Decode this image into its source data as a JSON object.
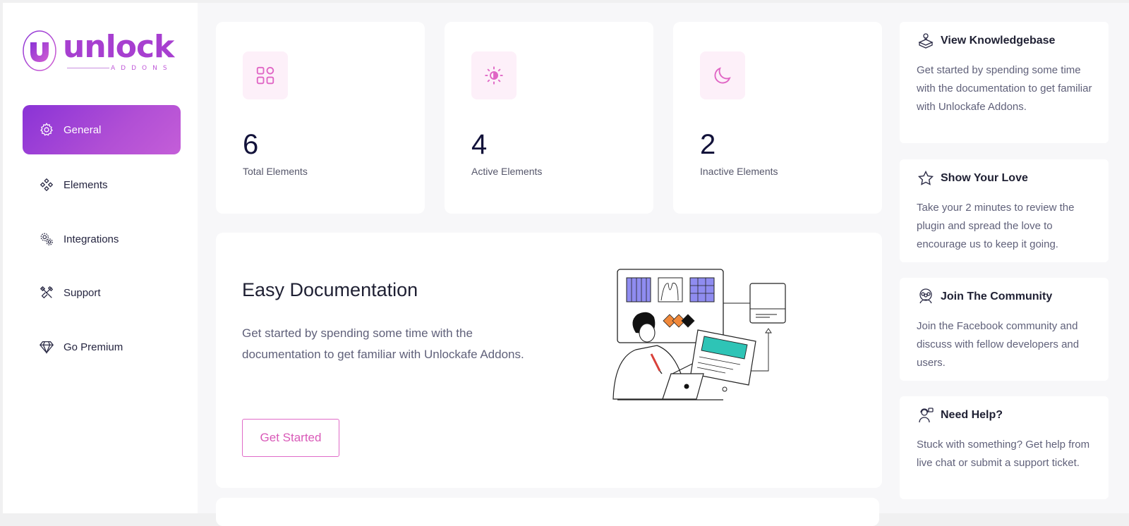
{
  "brand": {
    "name": "unlock",
    "tagline": "ADDONS",
    "accent": "#a73fd0"
  },
  "sidebar": {
    "items": [
      {
        "label": "General",
        "icon": "gear-icon",
        "active": true
      },
      {
        "label": "Elements",
        "icon": "elements-icon",
        "active": false
      },
      {
        "label": "Integrations",
        "icon": "integrations-icon",
        "active": false
      },
      {
        "label": "Support",
        "icon": "tools-icon",
        "active": false
      },
      {
        "label": "Go Premium",
        "icon": "diamond-icon",
        "active": false
      }
    ]
  },
  "stats": [
    {
      "value": "6",
      "label": "Total Elements",
      "icon": "grid-icon"
    },
    {
      "value": "4",
      "label": "Active Elements",
      "icon": "sun-icon"
    },
    {
      "value": "2",
      "label": "Inactive Elements",
      "icon": "moon-icon"
    }
  ],
  "documentation": {
    "title": "Easy Documentation",
    "text": "Get started by spending some time with the documentation to get familiar with Unlockafe Addons.",
    "button": "Get Started",
    "illustration": "developer-illustration"
  },
  "side_cards": [
    {
      "title": "View Knowledgebase",
      "icon": "knowledgebase-icon",
      "text": "Get started by spending some time with the documentation to get familiar with Unlockafe Addons."
    },
    {
      "title": "Show Your Love",
      "icon": "star-icon",
      "text": "Take your 2 minutes to review the plugin and spread the love to encourage us to keep it going."
    },
    {
      "title": "Join The Community",
      "icon": "community-icon",
      "text": "Join the Facebook community and discuss with fellow developers and users."
    },
    {
      "title": "Need Help?",
      "icon": "support-agent-icon",
      "text": "Stuck with something? Get help from live chat or submit a support ticket."
    }
  ],
  "colors": {
    "primary_gradient_start": "#8a33d6",
    "primary_gradient_end": "#c45ed8",
    "pink": "#d95ab8",
    "icon_bg": "#fdf0f9"
  }
}
